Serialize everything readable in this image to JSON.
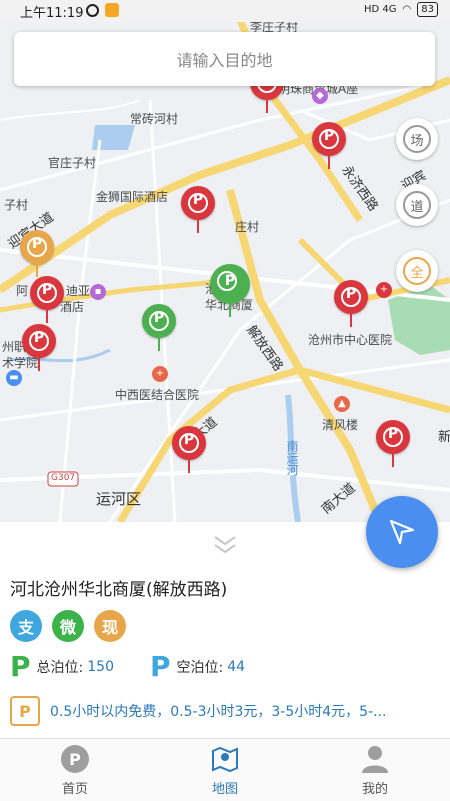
{
  "status_bar": {
    "time": "上午11:19",
    "network": "HD 4G",
    "battery": "83"
  },
  "search": {
    "placeholder": "请输入目的地"
  },
  "map": {
    "labels": {
      "lizhuang": "李庄子村",
      "mingzhu": "明珠商贸城A座",
      "changzhuan": "常砖河村",
      "guanzhuang": "官庄子村",
      "zizhuang": "子村",
      "jinshi": "金狮国际酒店",
      "zhuangcun": "庄村",
      "yingbin": "迎宾大道",
      "yongji": "永济西路",
      "yingbin2": "迎宾",
      "ahotel": "阿",
      "hotel_rest": "迪亚",
      "hotel_rest2": "酒店",
      "huabei": "华北商厦",
      "cangzhou": "沧",
      "jiefang": "解放西路",
      "center_hospital": "沧州市中心医院",
      "zhi": "州职",
      "xueyuan": "术学院",
      "zhongxi": "中西医结合医院",
      "qingfeng": "清风楼",
      "nanyunhe": "南运河",
      "road_g307": "G307",
      "yunhe": "运河区",
      "nandadao": "南大道",
      "nandadao2": "南大道",
      "xin": "新"
    },
    "side_buttons": [
      "场",
      "道",
      "全"
    ]
  },
  "card": {
    "title": "河北沧州华北商厦(解放西路)",
    "payments": [
      "支",
      "微",
      "现"
    ],
    "total_label": "总泊位:",
    "total_value": "150",
    "free_label": "空泊位:",
    "free_value": "44",
    "price": "0.5小时以内免费，0.5-3小时3元，3-5小时4元，5-..."
  },
  "tabs": [
    {
      "label": "首页"
    },
    {
      "label": "地图"
    },
    {
      "label": "我的"
    }
  ],
  "colors": {
    "accent": "#2a7ab8",
    "pin_red": "#d9363e",
    "pin_green": "#4caf50",
    "pin_orange": "#e8a64a",
    "locate": "#4a8fef"
  }
}
